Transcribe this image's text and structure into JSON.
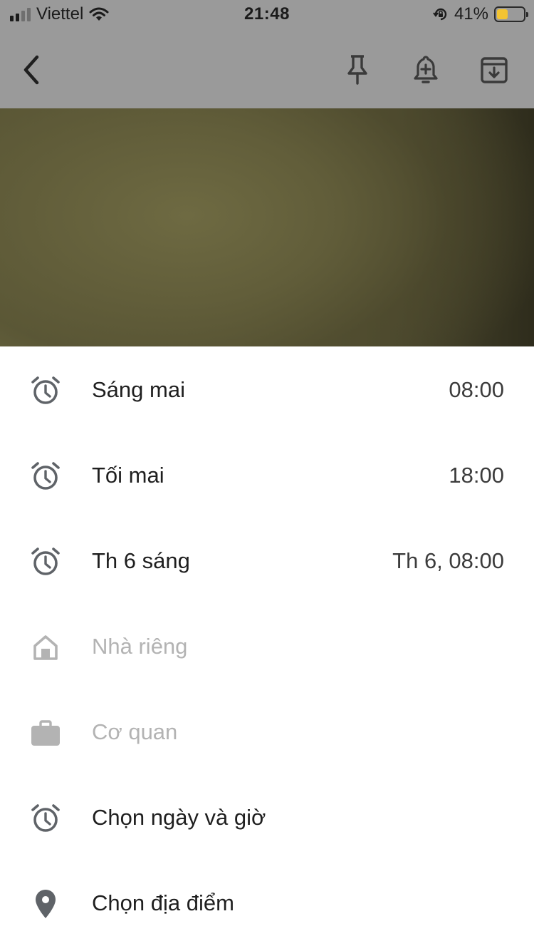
{
  "status_bar": {
    "carrier": "Viettel",
    "time": "21:48",
    "battery_percent": "41%",
    "battery_level": 0.41,
    "icons": [
      "signal-icon",
      "wifi-icon",
      "orientation-lock-icon",
      "battery-icon"
    ]
  },
  "toolbar": {
    "icons": [
      "back-arrow-icon",
      "pin-icon",
      "add-reminder-icon",
      "archive-icon"
    ]
  },
  "reminder_options": [
    {
      "label": "Sáng mai",
      "value": "08:00",
      "icon": "alarm-icon",
      "enabled": true
    },
    {
      "label": "Tối mai",
      "value": "18:00",
      "icon": "alarm-icon",
      "enabled": true
    },
    {
      "label": "Th 6 sáng",
      "value": "Th 6, 08:00",
      "icon": "alarm-icon",
      "enabled": true
    },
    {
      "label": "Nhà riêng",
      "value": "",
      "icon": "home-icon",
      "enabled": false
    },
    {
      "label": "Cơ quan",
      "value": "",
      "icon": "briefcase-icon",
      "enabled": false
    },
    {
      "label": "Chọn ngày và giờ",
      "value": "",
      "icon": "alarm-icon",
      "enabled": true
    },
    {
      "label": "Chọn địa điểm",
      "value": "",
      "icon": "location-pin-icon",
      "enabled": true
    }
  ],
  "colors": {
    "overlay_gray": "#9a9a9a",
    "icon_dark": "#5f6368",
    "icon_disabled": "#b3b3b3",
    "battery_yellow": "#f3c431"
  }
}
